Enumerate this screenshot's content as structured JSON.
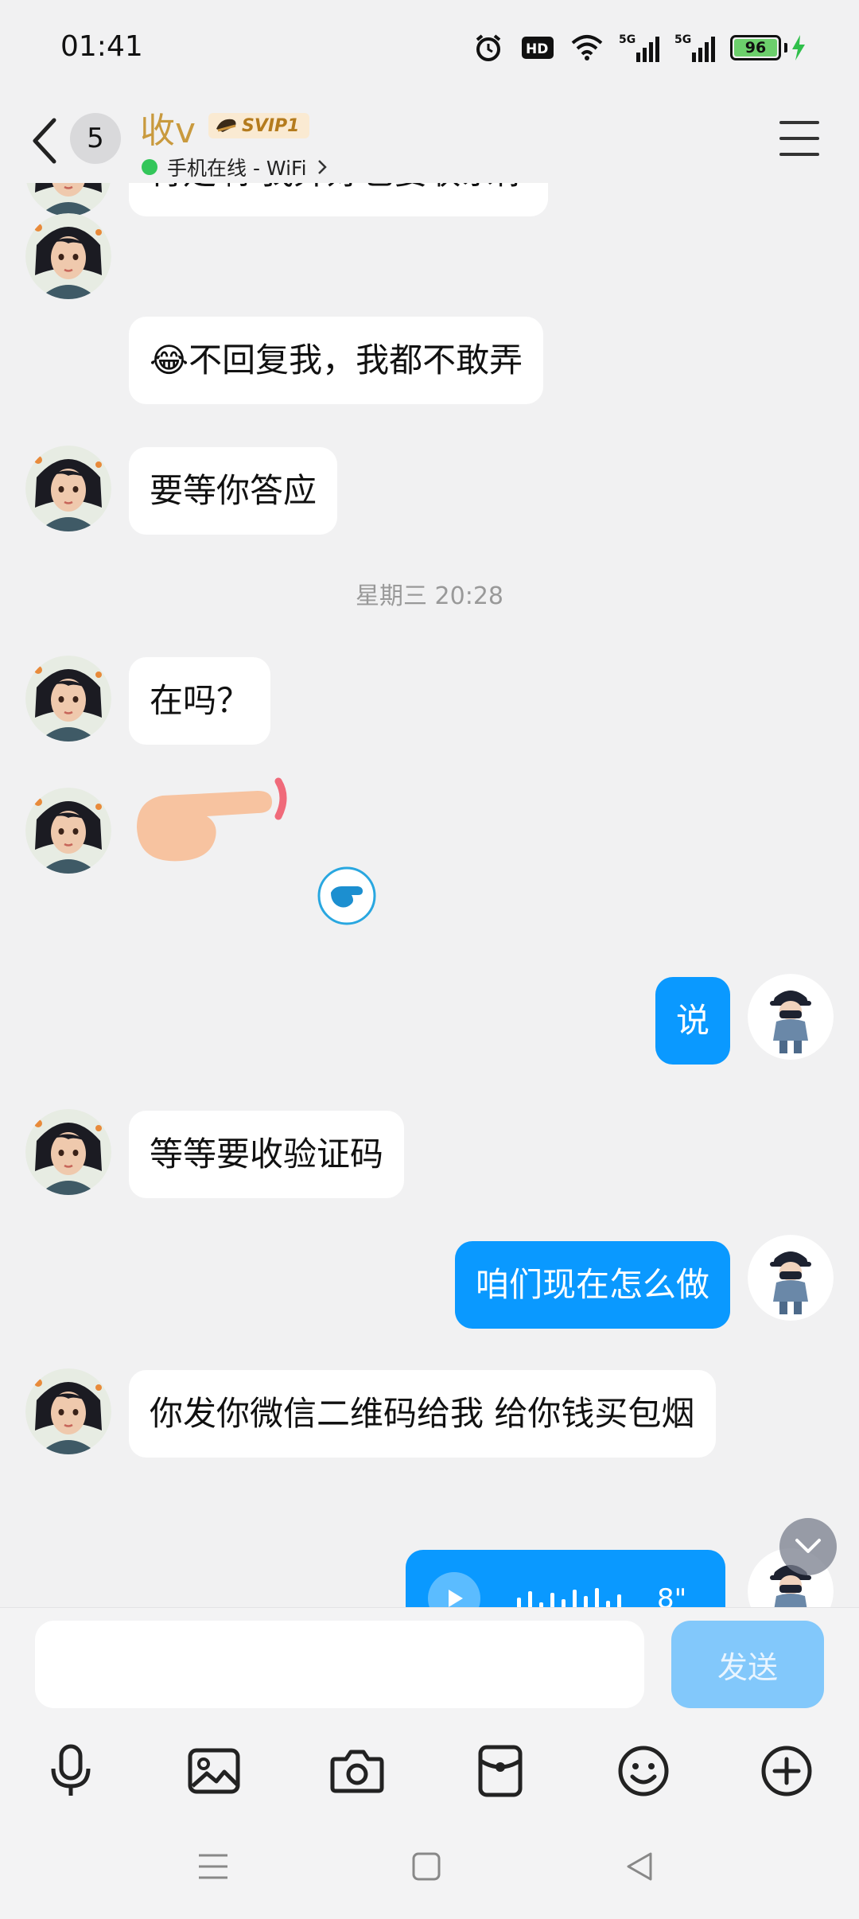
{
  "status_bar": {
    "time": "01:41",
    "hd_label": "HD",
    "signal1_label": "5G",
    "signal2_label": "5G",
    "battery": "96"
  },
  "header": {
    "unread_count": "5",
    "contact_name": "收v",
    "vip_label": "SVIP1",
    "online_status": "手机在线 - WiFi"
  },
  "messages": [
    {
      "side": "in",
      "text": "肯定啊  我弄好也要联系你"
    },
    {
      "side": "in",
      "text": "😂不回复我，我都不敢弄"
    },
    {
      "side": "in",
      "text": "要等你答应"
    },
    {
      "side": "in",
      "text": "在吗？"
    },
    {
      "side": "out",
      "text": "说"
    },
    {
      "side": "in",
      "text": "等等要收验证码"
    },
    {
      "side": "out",
      "text": "咱们现在怎么做"
    },
    {
      "side": "in",
      "text": "你发你微信二维码给我   给你钱买包烟"
    }
  ],
  "time_divider": "星期三 20:28",
  "voice_message": {
    "duration": "8\""
  },
  "composer": {
    "placeholder": "",
    "send_label": "发送"
  },
  "toolbar_icons": [
    "mic-icon",
    "image-icon",
    "camera-icon",
    "red-packet-icon",
    "emoji-icon",
    "plus-icon"
  ],
  "colors": {
    "accent": "#0a99ff",
    "name_gold": "#c99a3e",
    "online_green": "#33c65a",
    "send_disabled": "#82c8fb"
  }
}
